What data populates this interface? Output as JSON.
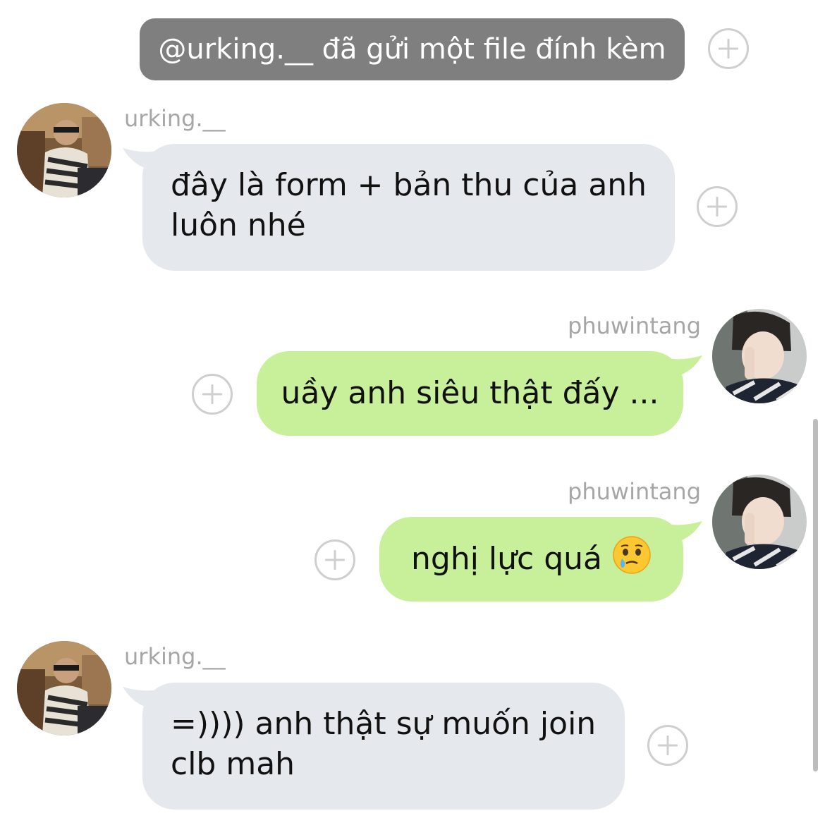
{
  "notice": {
    "text": "@urking.__ đã gửi một file đính kèm"
  },
  "messages": [
    {
      "sender": "urking.__",
      "side": "left",
      "lines": [
        "đây là form + bản thu của anh",
        "luôn nhé"
      ]
    },
    {
      "sender": "phuwintang",
      "side": "right",
      "text": "uầy anh siêu thật đấy ..."
    },
    {
      "sender": "phuwintang",
      "side": "right",
      "text": "nghị lực quá",
      "emoji_icon": "face-holding-back-tears-icon"
    },
    {
      "sender": "urking.__",
      "side": "left",
      "lines": [
        "=)))) anh thật sự muốn join",
        "clb mah"
      ]
    }
  ],
  "colors": {
    "background": "#ffffff",
    "notice_bg": "#7f7f7f",
    "incoming_bubble": "#e5e8ec",
    "outgoing_bubble": "#c8ef9a",
    "sender_text": "#a6a6a6",
    "plus_outline": "#cfcfcf"
  }
}
